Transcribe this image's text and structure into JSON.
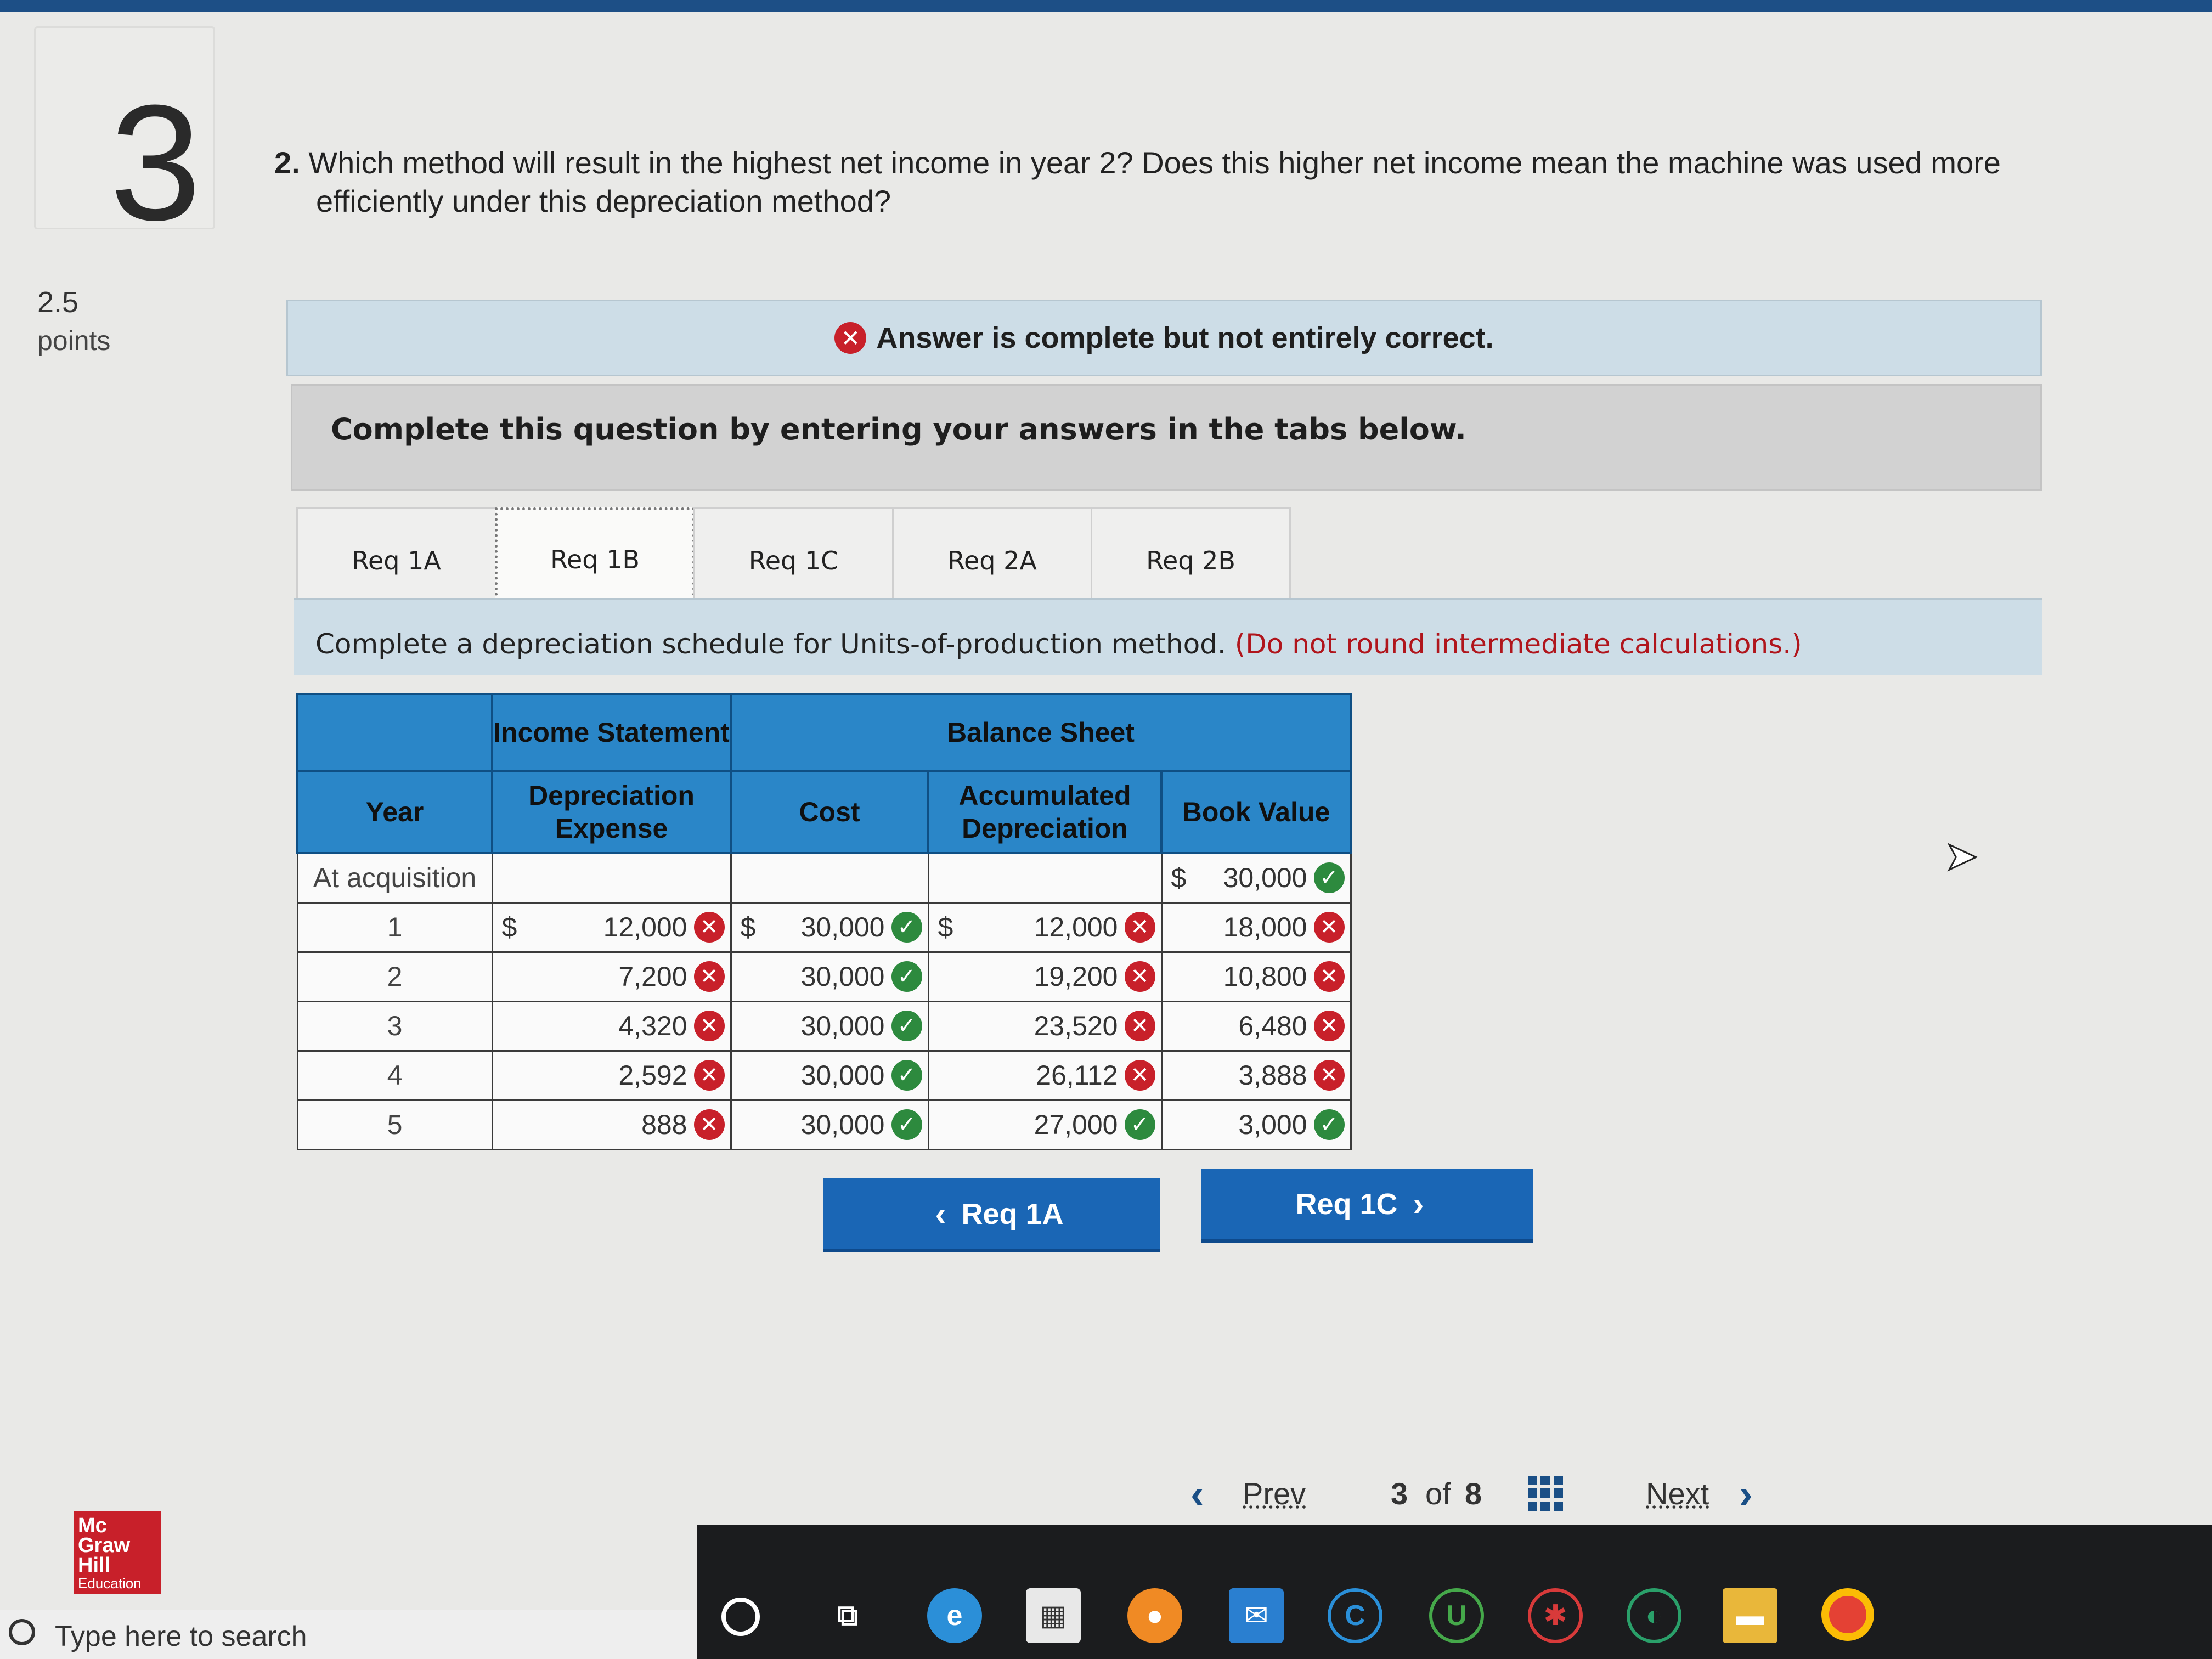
{
  "question": {
    "number": "3",
    "points_value": "2.5",
    "points_label": "points",
    "prompt_number": "2.",
    "prompt_line1": "Which method will result in the highest net income in year 2? Does this higher net income mean the machine was used more",
    "prompt_line2": "efficiently under this depreciation method?"
  },
  "feedback": {
    "icon": "x-circle-icon",
    "text": "Answer is complete but not entirely correct."
  },
  "instructions": "Complete this question by entering your answers in the tabs below.",
  "tabs": [
    {
      "label": "Req 1A",
      "active": false
    },
    {
      "label": "Req 1B",
      "active": true
    },
    {
      "label": "Req 1C",
      "active": false
    },
    {
      "label": "Req 2A",
      "active": false
    },
    {
      "label": "Req 2B",
      "active": false
    }
  ],
  "panel": {
    "heading": "Complete a depreciation schedule for Units-of-production method.",
    "note": "(Do not round intermediate calculations.)"
  },
  "schedule": {
    "group_income": "Income Statement",
    "group_balance": "Balance Sheet",
    "col_year": "Year",
    "col_dep_exp": "Depreciation Expense",
    "col_cost": "Cost",
    "col_accum": "Accumulated Depreciation",
    "col_book": "Book Value",
    "currency": "$",
    "rows": [
      {
        "year": "At acquisition",
        "dep": "",
        "dep_ok": null,
        "cost": "",
        "cost_ok": null,
        "accum": "",
        "accum_ok": null,
        "book": "30,000",
        "book_ok": true
      },
      {
        "year": "1",
        "dep": "12,000",
        "dep_ok": false,
        "cost": "30,000",
        "cost_ok": true,
        "accum": "12,000",
        "accum_ok": false,
        "book": "18,000",
        "book_ok": false
      },
      {
        "year": "2",
        "dep": "7,200",
        "dep_ok": false,
        "cost": "30,000",
        "cost_ok": true,
        "accum": "19,200",
        "accum_ok": false,
        "book": "10,800",
        "book_ok": false
      },
      {
        "year": "3",
        "dep": "4,320",
        "dep_ok": false,
        "cost": "30,000",
        "cost_ok": true,
        "accum": "23,520",
        "accum_ok": false,
        "book": "6,480",
        "book_ok": false
      },
      {
        "year": "4",
        "dep": "2,592",
        "dep_ok": false,
        "cost": "30,000",
        "cost_ok": true,
        "accum": "26,112",
        "accum_ok": false,
        "book": "3,888",
        "book_ok": false
      },
      {
        "year": "5",
        "dep": "888",
        "dep_ok": false,
        "cost": "30,000",
        "cost_ok": true,
        "accum": "27,000",
        "accum_ok": true,
        "book": "3,000",
        "book_ok": true
      }
    ]
  },
  "nav": {
    "prev_tab": "Req 1A",
    "next_tab": "Req 1C"
  },
  "pager": {
    "prev": "Prev",
    "current": "3",
    "of": "of",
    "total": "8",
    "next": "Next"
  },
  "logo": {
    "l1": "Mc",
    "l2": "Graw",
    "l3": "Hill",
    "l4": "Education"
  },
  "taskbar": {
    "search_placeholder": "Type here to search"
  },
  "colors": {
    "header_blue": "#2a86c8",
    "button_blue": "#1a66b5",
    "correct_green": "#2d8a3e",
    "wrong_red": "#c8202a"
  }
}
